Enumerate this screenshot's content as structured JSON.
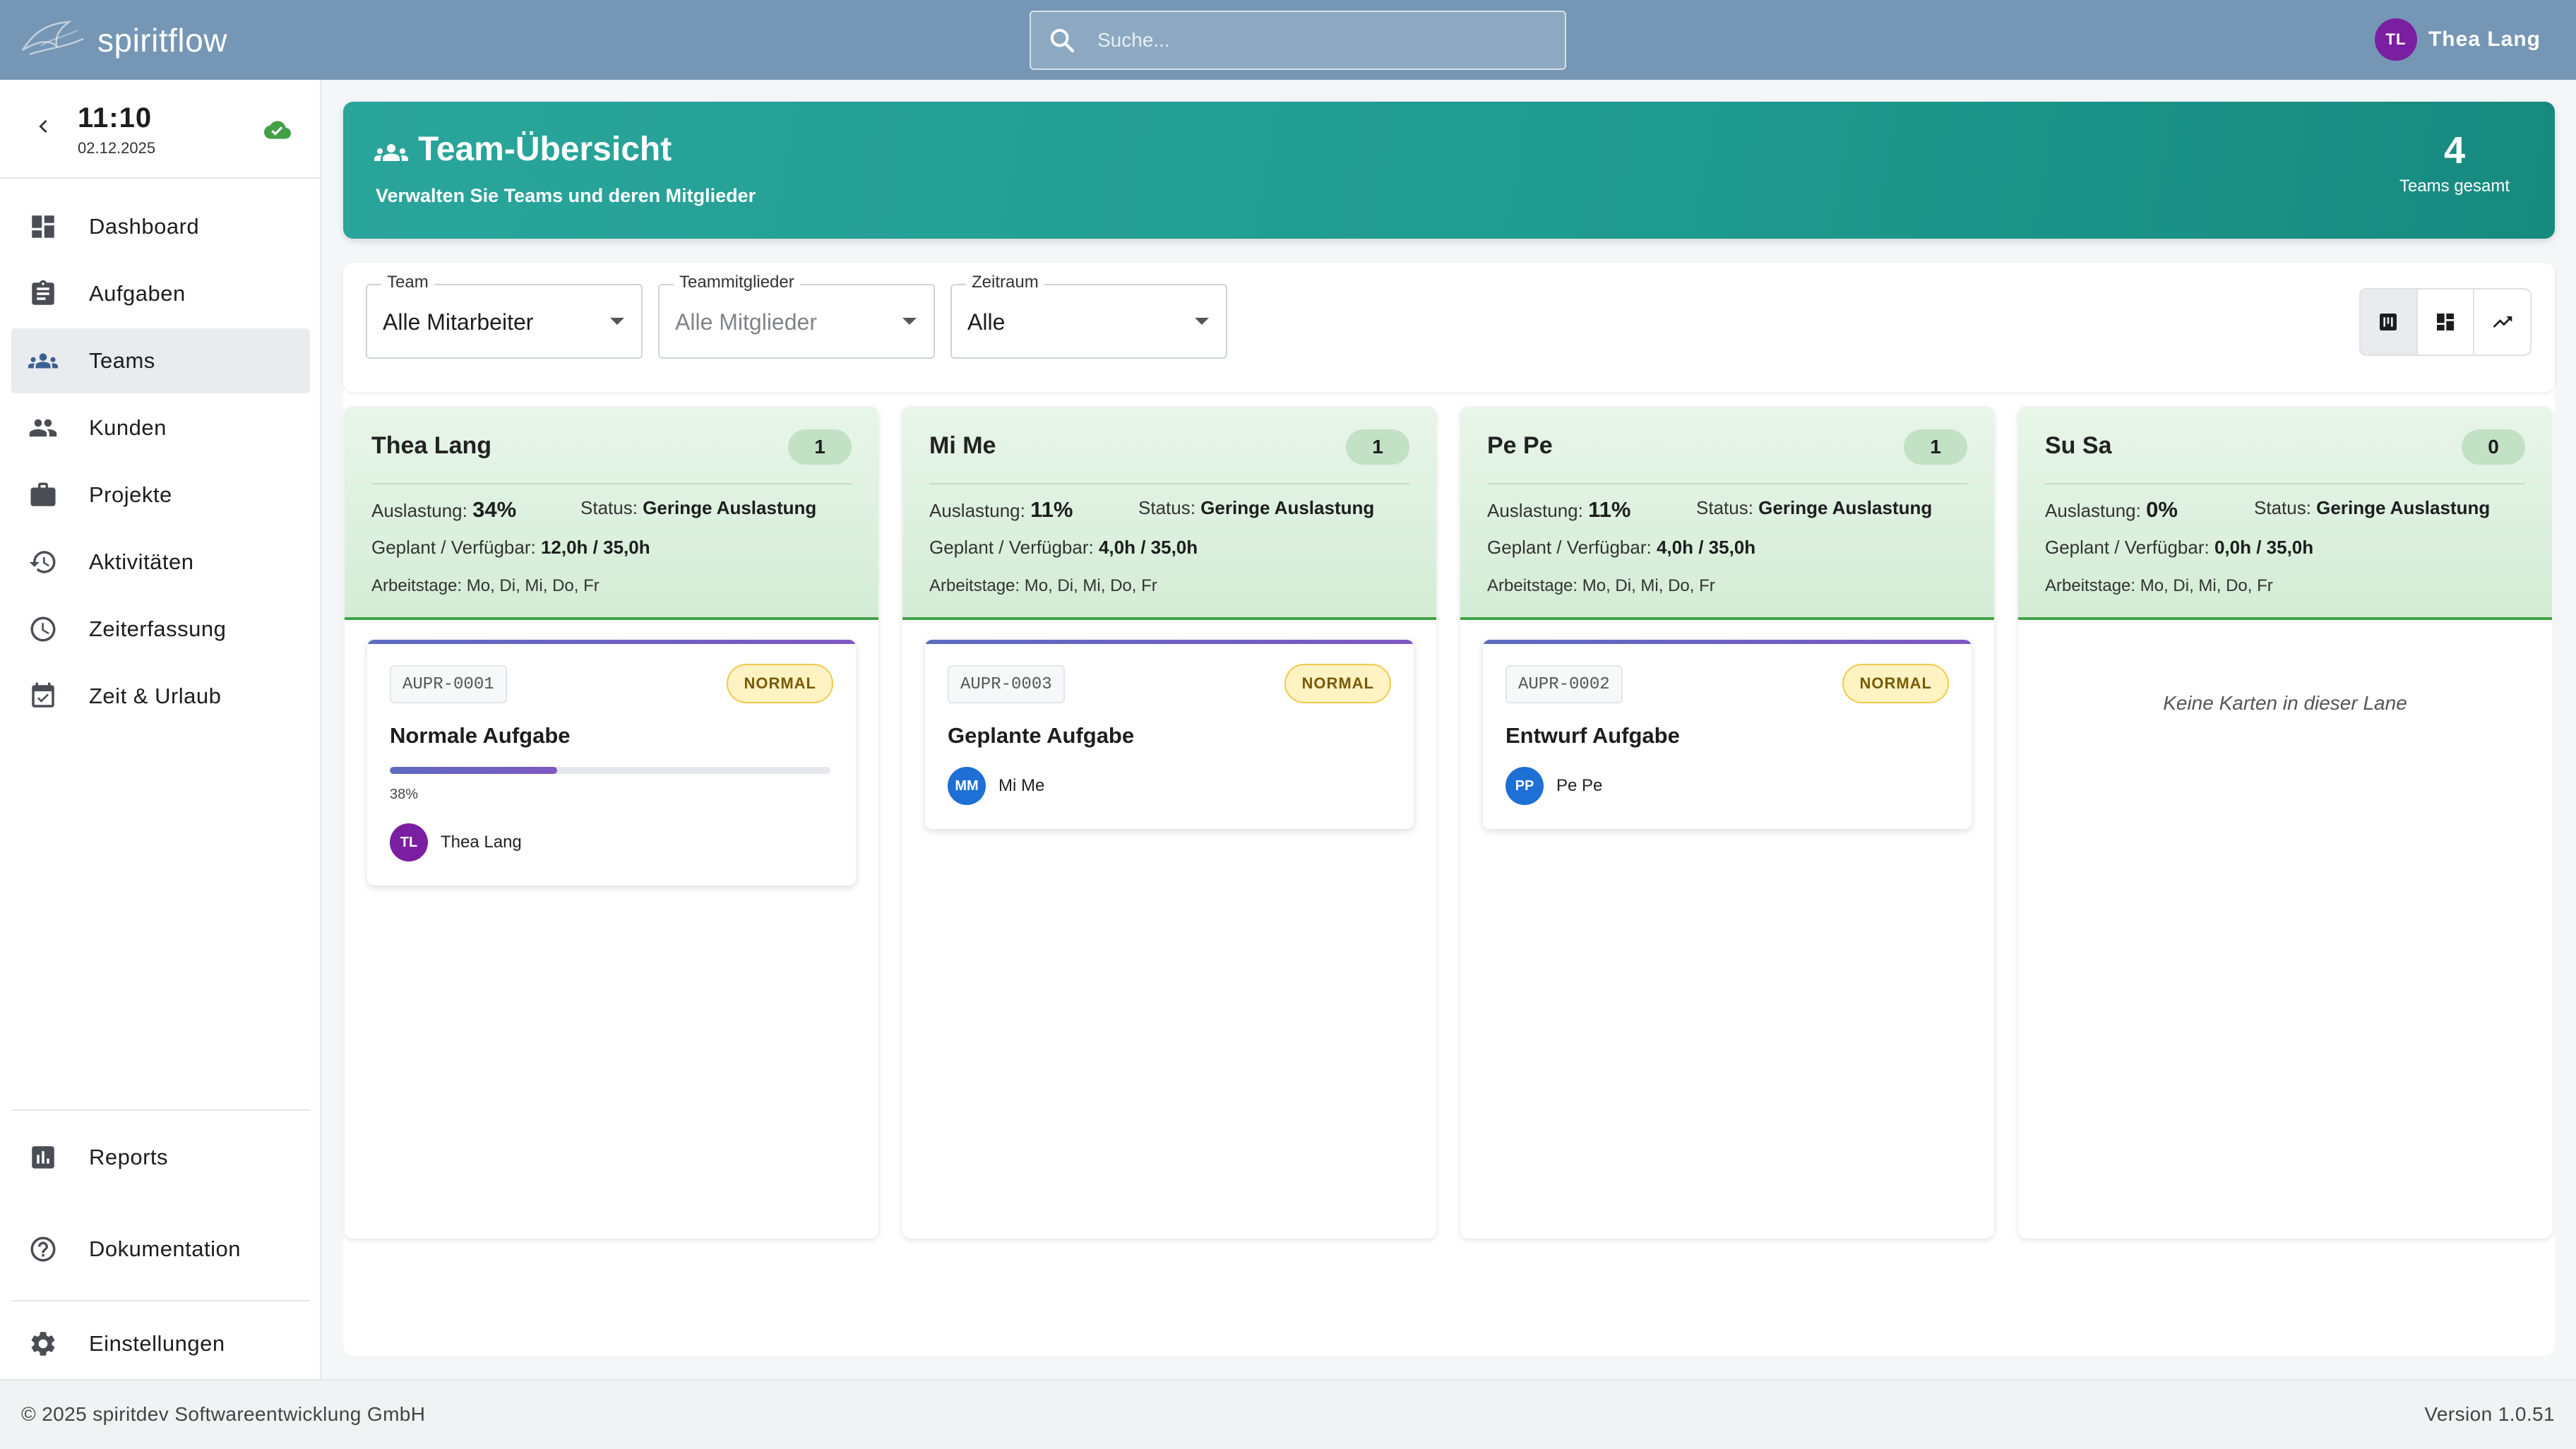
{
  "app": {
    "name": "spiritflow"
  },
  "search": {
    "placeholder": "Suche..."
  },
  "user": {
    "initials": "TL",
    "name": "Thea Lang",
    "avatar_color": "#7b1fa2"
  },
  "clock": {
    "time": "11:10",
    "date": "02.12.2025"
  },
  "sidebar": {
    "items": [
      {
        "label": "Dashboard",
        "icon": "dashboard-icon"
      },
      {
        "label": "Aufgaben",
        "icon": "clipboard-icon"
      },
      {
        "label": "Teams",
        "icon": "team-icon",
        "active": true
      },
      {
        "label": "Kunden",
        "icon": "people-icon"
      },
      {
        "label": "Projekte",
        "icon": "briefcase-icon"
      },
      {
        "label": "Aktivitäten",
        "icon": "history-icon"
      },
      {
        "label": "Zeiterfassung",
        "icon": "clock-icon"
      },
      {
        "label": "Zeit & Urlaub",
        "icon": "calendar-check-icon"
      }
    ],
    "bottom": [
      {
        "label": "Reports",
        "icon": "bar-chart-icon"
      },
      {
        "label": "Dokumentation",
        "icon": "help-icon"
      },
      {
        "label": "Einstellungen",
        "icon": "gear-icon"
      }
    ]
  },
  "header": {
    "title": "Team-Übersicht",
    "subtitle": "Verwalten Sie Teams und deren Mitglieder",
    "count": "4",
    "count_label": "Teams gesamt"
  },
  "filters": {
    "team": {
      "label": "Team",
      "value": "Alle Mitarbeiter"
    },
    "members": {
      "label": "Teammitglieder",
      "placeholder": "Alle Mitglieder"
    },
    "period": {
      "label": "Zeitraum",
      "value": "Alle"
    }
  },
  "lanes": [
    {
      "name": "Thea Lang",
      "count": "1",
      "load_label": "Auslastung:",
      "load": "34%",
      "status_label": "Status:",
      "status": "Geringe Auslastung",
      "plan_label": "Geplant / Verfügbar:",
      "plan": "12,0h / 35,0h",
      "days_label": "Arbeitstage:",
      "days": "Mo, Di, Mi, Do, Fr",
      "card": {
        "code": "AUPR-0001",
        "priority": "NORMAL",
        "title": "Normale Aufgabe",
        "progress": 38,
        "progress_text": "38%",
        "assignee_initials": "TL",
        "assignee": "Thea Lang",
        "assignee_color": "#7b1fa2"
      }
    },
    {
      "name": "Mi Me",
      "count": "1",
      "load_label": "Auslastung:",
      "load": "11%",
      "status_label": "Status:",
      "status": "Geringe Auslastung",
      "plan_label": "Geplant / Verfügbar:",
      "plan": "4,0h / 35,0h",
      "days_label": "Arbeitstage:",
      "days": "Mo, Di, Mi, Do, Fr",
      "card": {
        "code": "AUPR-0003",
        "priority": "NORMAL",
        "title": "Geplante Aufgabe",
        "assignee_initials": "MM",
        "assignee": "Mi Me",
        "assignee_color": "#1e6fd6"
      }
    },
    {
      "name": "Pe Pe",
      "count": "1",
      "load_label": "Auslastung:",
      "load": "11%",
      "status_label": "Status:",
      "status": "Geringe Auslastung",
      "plan_label": "Geplant / Verfügbar:",
      "plan": "4,0h / 35,0h",
      "days_label": "Arbeitstage:",
      "days": "Mo, Di, Mi, Do, Fr",
      "card": {
        "code": "AUPR-0002",
        "priority": "NORMAL",
        "title": "Entwurf Aufgabe",
        "assignee_initials": "PP",
        "assignee": "Pe Pe",
        "assignee_color": "#1e6fd6"
      }
    },
    {
      "name": "Su Sa",
      "count": "0",
      "load_label": "Auslastung:",
      "load": "0%",
      "status_label": "Status:",
      "status": "Geringe Auslastung",
      "plan_label": "Geplant / Verfügbar:",
      "plan": "0,0h / 35,0h",
      "days_label": "Arbeitstage:",
      "days": "Mo, Di, Mi, Do, Fr",
      "empty": "Keine Karten in dieser Lane"
    }
  ],
  "footer": {
    "copyright": "© 2025 spiritdev Softwareentwicklung GmbH",
    "version": "Version 1.0.51"
  },
  "colors": {
    "topbar": "#7596b5",
    "banner": "#1f9a8e",
    "lane_accent": "#43a047"
  }
}
